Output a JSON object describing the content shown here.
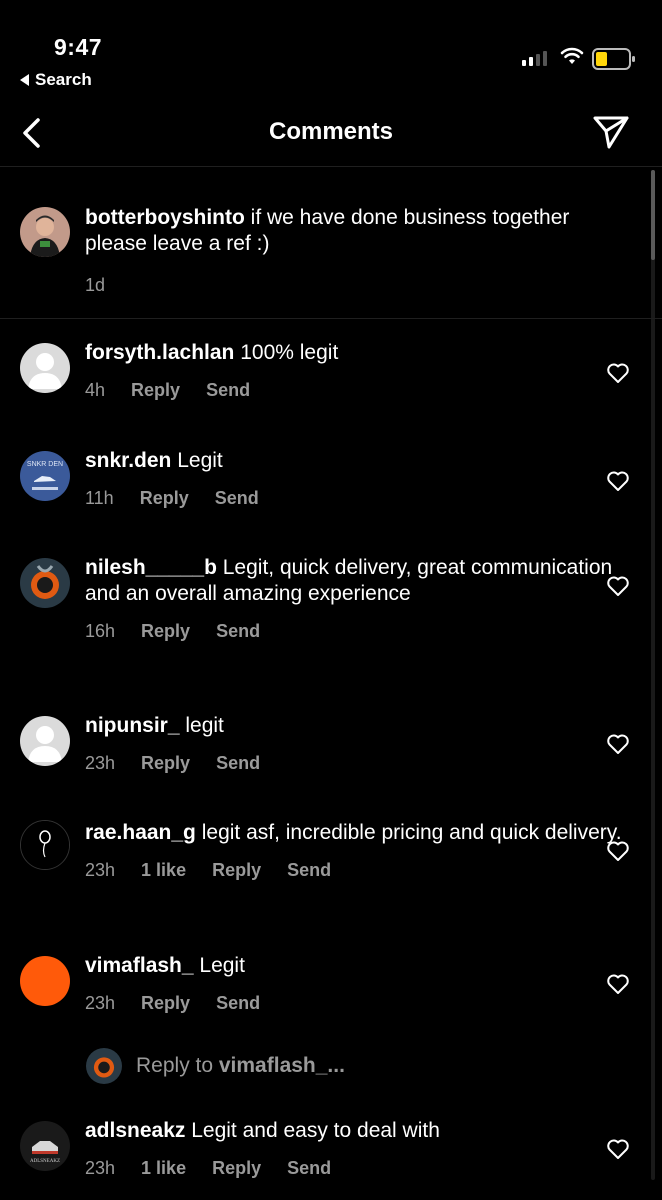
{
  "status_bar": {
    "time": "9:47",
    "back_label": "Search"
  },
  "header": {
    "title": "Comments"
  },
  "caption": {
    "username": "botterboyshinto",
    "text": " if we have done business together please leave a ref :)",
    "age": "1d"
  },
  "comments": [
    {
      "username": "forsyth.lachlan",
      "text": " 100% legit",
      "age": "4h",
      "likes": "",
      "reply": "Reply",
      "send": "Send"
    },
    {
      "username": "snkr.den",
      "text": " Legit",
      "age": "11h",
      "likes": "",
      "reply": "Reply",
      "send": "Send"
    },
    {
      "username": "nilesh_____b",
      "text": " Legit, quick delivery, great communication and an overall amazing experience",
      "age": "16h",
      "likes": "",
      "reply": "Reply",
      "send": "Send"
    },
    {
      "username": "nipunsir_",
      "text": " legit",
      "age": "23h",
      "likes": "",
      "reply": "Reply",
      "send": "Send"
    },
    {
      "username": "rae.haan_g",
      "text": " legit asf, incredible pricing and quick delivery.",
      "age": "23h",
      "likes": "1 like",
      "reply": "Reply",
      "send": "Send"
    },
    {
      "username": "vimaflash_",
      "text": " Legit",
      "age": "23h",
      "likes": "",
      "reply": "Reply",
      "send": "Send"
    },
    {
      "username": "adlsneakz",
      "text": " Legit and easy to deal with",
      "age": "23h",
      "likes": "1 like",
      "reply": "Reply",
      "send": "Send"
    }
  ],
  "reply_prompt": {
    "prefix": "Reply to ",
    "target": "vimaflash_..."
  },
  "avatars": {
    "snkr_den_text": "SNKR DEN",
    "adlsneakz_text": "ADLSNEAKZ"
  },
  "colors": {
    "background": "#000000",
    "secondary_text": "#9a9a9a",
    "battery_fill": "#ffd60a",
    "vimaflash_avatar": "#ff5a0a"
  }
}
